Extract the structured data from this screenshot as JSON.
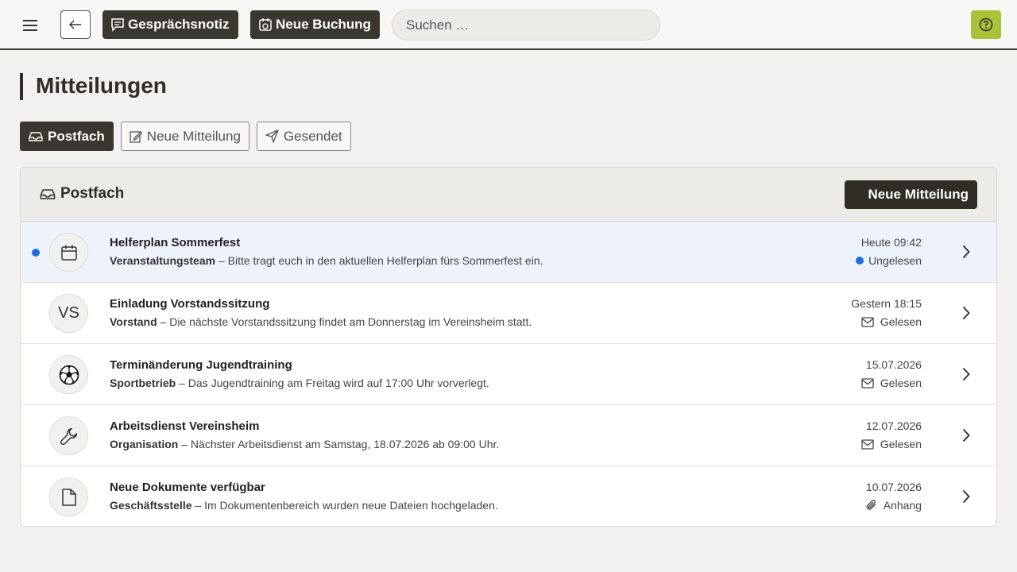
{
  "topbar": {
    "note_label": "Gesprächsnotiz",
    "booking_label": "Neue Buchung",
    "search_placeholder": "Suchen …"
  },
  "page": {
    "title": "Mitteilungen"
  },
  "tabs": [
    {
      "label": "Postfach",
      "icon": "inbox-icon",
      "active": true
    },
    {
      "label": "Neue Mitteilung",
      "icon": "edit-icon",
      "active": false
    },
    {
      "label": "Gesendet",
      "icon": "send-icon",
      "active": false
    }
  ],
  "panel": {
    "title": "Postfach",
    "new_button": "Neue Mitteilung"
  },
  "messages": [
    {
      "subject": "Helferplan Sommerfest",
      "sender": "Veranstaltungsteam",
      "text": "– Bitte tragt euch in den aktuellen Helferplan fürs Sommerfest ein.",
      "date": "Heute 09:42",
      "status": "Ungelesen",
      "status_icon": "unread-dot",
      "avatar": "calendar-icon",
      "unread": true
    },
    {
      "subject": "Einladung Vorstandssitzung",
      "sender": "Vorstand",
      "text": "– Die nächste Vorstandssitzung findet am Donnerstag im Vereinsheim statt.",
      "date": "Gestern 18:15",
      "status": "Gelesen",
      "status_icon": "envelope-icon",
      "avatar_text": "VS",
      "unread": false
    },
    {
      "subject": "Terminänderung Jugendtraining",
      "sender": "Sportbetrieb",
      "text": "– Das Jugendtraining am Freitag wird auf 17:00 Uhr vorverlegt.",
      "date": "15.07.2026",
      "status": "Gelesen",
      "status_icon": "envelope-icon",
      "avatar": "soccer-ball-icon",
      "unread": false
    },
    {
      "subject": "Arbeitsdienst Vereinsheim",
      "sender": "Organisation",
      "text": "– Nächster Arbeitsdienst am Samstag, 18.07.2026 ab 09:00 Uhr.",
      "date": "12.07.2026",
      "status": "Gelesen",
      "status_icon": "envelope-icon",
      "avatar": "wrench-icon",
      "unread": false
    },
    {
      "subject": "Neue Dokumente verfügbar",
      "sender": "Geschäftsstelle",
      "text": "– Im Dokumentenbereich wurden neue Dateien hochgeladen.",
      "date": "10.07.2026",
      "status": "Anhang",
      "status_icon": "paperclip-icon",
      "avatar": "document-icon",
      "unread": false
    }
  ],
  "colors": {
    "primary_dark": "#3a372e",
    "help_accent": "#a9c23a",
    "unread_blue": "#1d6fd8",
    "unread_row_bg": "#eef3fb"
  }
}
